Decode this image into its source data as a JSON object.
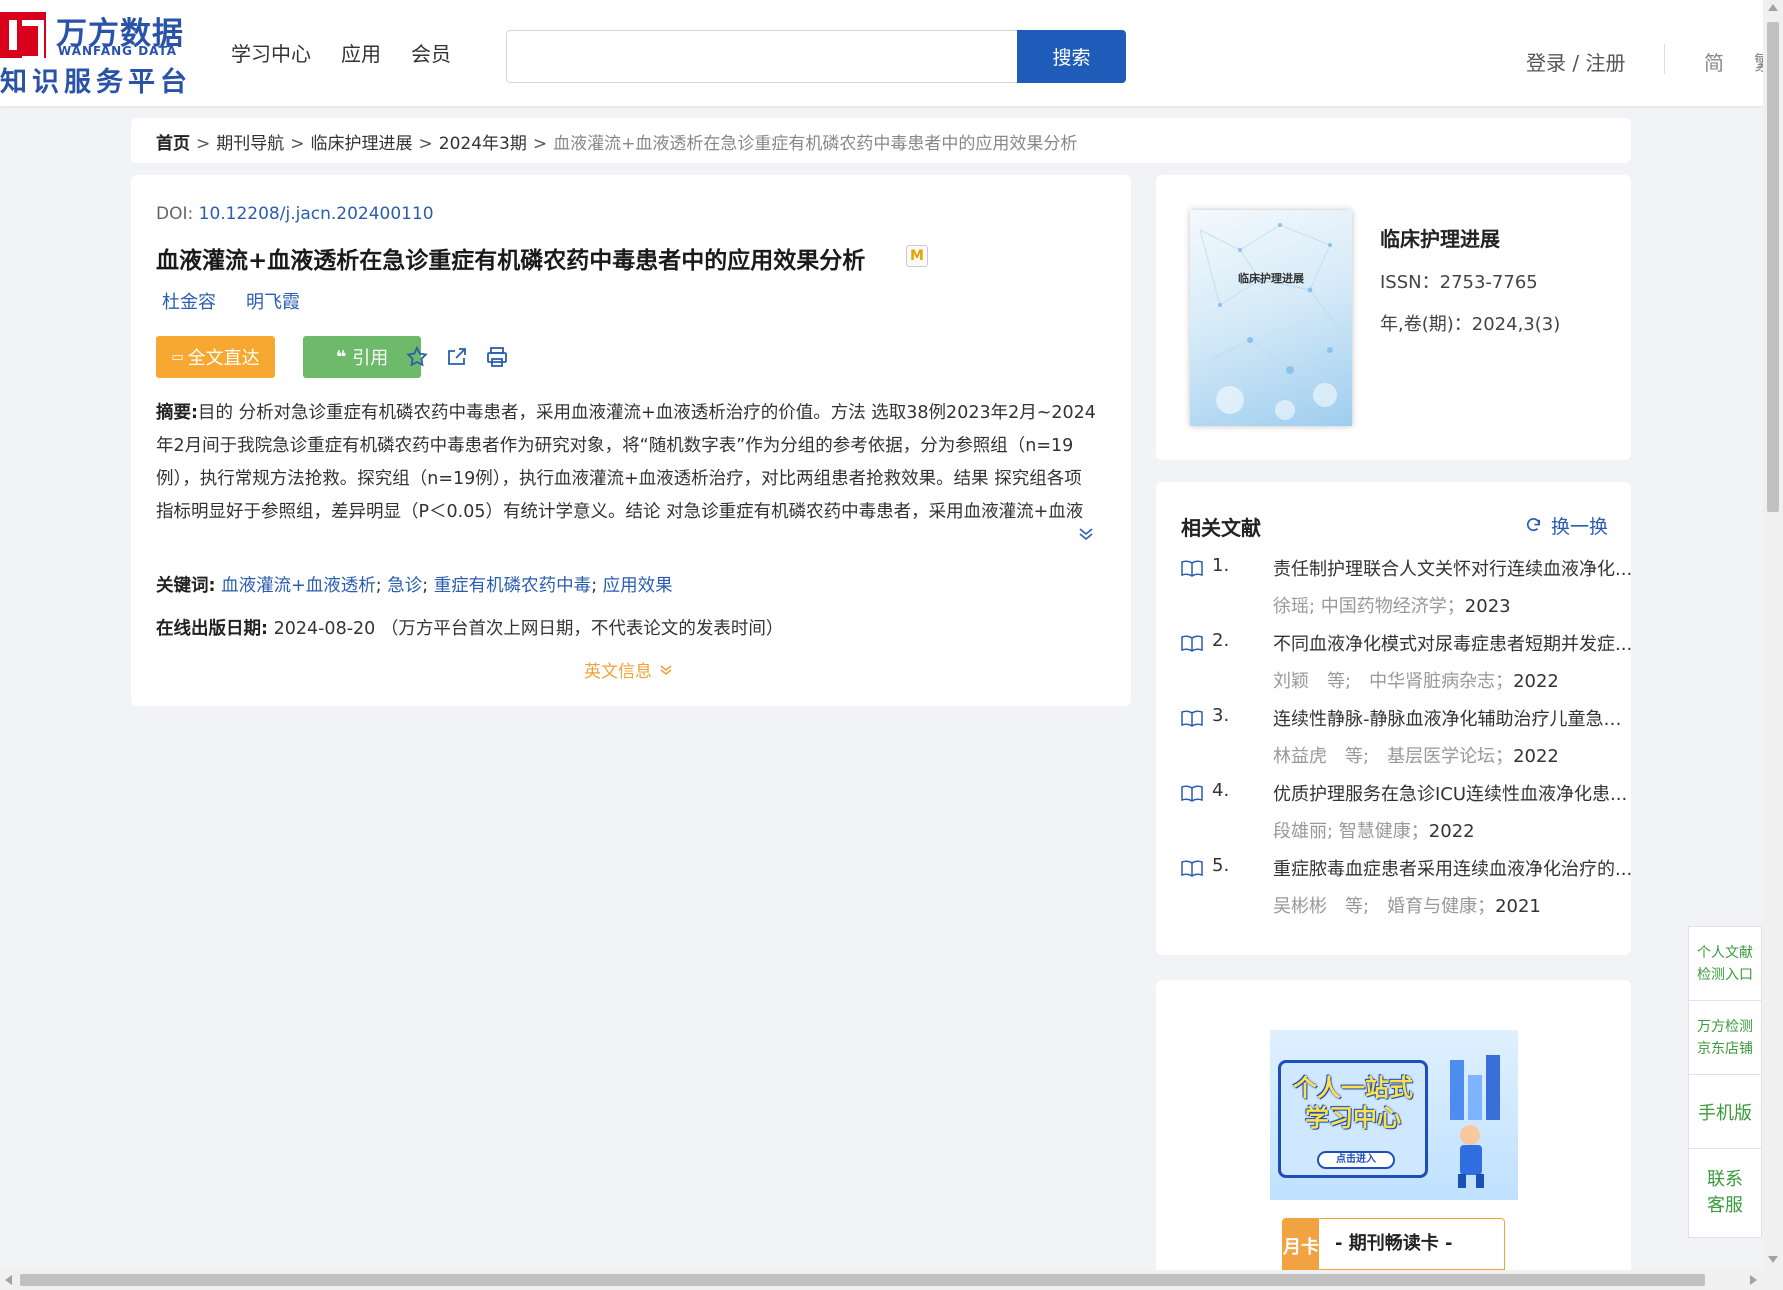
{
  "header": {
    "logo_cn": "万方数据",
    "logo_en": "WANFANG DATA",
    "logo_sub": "知识服务平台",
    "nav": [
      "学习中心",
      "应用",
      "会员"
    ],
    "search_placeholder": "",
    "search_button": "搜索",
    "login": "登录 / 注册",
    "lang_simplified": "简",
    "lang_traditional": "繁"
  },
  "breadcrumb": {
    "home": "首页",
    "items": [
      "期刊导航",
      "临床护理进展",
      "2024年3期"
    ],
    "current": "血液灌流+血液透析在急诊重症有机磷农药中毒患者中的应用效果分析",
    "separator": ">"
  },
  "article": {
    "doi_label": "DOI:",
    "doi": "10.12208/j.jacn.202400110",
    "title": "血液灌流+血液透析在急诊重症有机磷农药中毒患者中的应用效果分析",
    "badge": "M",
    "authors": [
      "杜金容",
      "明飞霞"
    ],
    "btn_full_text": "全文直达",
    "btn_cite": "引用",
    "abstract_label": "摘要:",
    "abstract": "目的 分析对急诊重症有机磷农药中毒患者，采用血液灌流+血液透析治疗的价值。方法 选取38例2023年2月~2024年2月间于我院急诊重症有机磷农药中毒患者作为研究对象，将“随机数字表”作为分组的参考依据，分为参照组（n=19例），执行常规方法抢救。探究组（n=19例），执行血液灌流+血液透析治疗，对比两组患者抢救效果。结果 探究组各项指标明显好于参照组，差异明显（P＜0.05）有统计学意义。结论 对急诊重症有机磷农药中毒患者，采用血液灌流+血液透析治疗，有助于提高患者治疗有效率，降低患者并发症，对改善患者苏醒时间，住院时间，胆碱酯酶恢复正常时间，阿...",
    "keywords_label": "关键词:",
    "keywords": [
      "血液灌流+血液透析",
      "急诊",
      "重症有机磷农药中毒",
      "应用效果"
    ],
    "pubdate_label": "在线出版日期:",
    "pubdate": "2024-08-20",
    "pubdate_note": "（万方平台首次上网日期，不代表论文的发表时间）",
    "english_info": "英文信息"
  },
  "journal": {
    "name": "临床护理进展",
    "cover_title": "临床护理进展",
    "issn": "ISSN：2753-7765",
    "volume": "年,卷(期)：2024,3(3)"
  },
  "related": {
    "heading": "相关文献",
    "refresh": "换一换",
    "items": [
      {
        "num": "1.",
        "title": "责任制护理联合人文关怀对行连续血液净化...",
        "meta": "徐瑶; 中国药物经济学；",
        "year": "2023"
      },
      {
        "num": "2.",
        "title": "不同血液净化模式对尿毒症患者短期并发症...",
        "meta": "刘颖　等;　中华肾脏病杂志；",
        "year": "2022"
      },
      {
        "num": "3.",
        "title": "连续性静脉-静脉血液净化辅助治疗儿童急性...",
        "meta": "林益虎　等;　基层医学论坛；",
        "year": "2022"
      },
      {
        "num": "4.",
        "title": "优质护理服务在急诊ICU连续性血液净化患...",
        "meta": "段雄丽; 智慧健康；",
        "year": "2022"
      },
      {
        "num": "5.",
        "title": "重症脓毒血症患者采用连续血液净化治疗的...",
        "meta": "吴彬彬　等;　婚育与健康；",
        "year": "2021"
      }
    ]
  },
  "promo": {
    "banner_line1": "个人一站式",
    "banner_line2": "学习中心",
    "banner_button": "点击进入",
    "card_tag": "月卡",
    "card_label": "- 期刊畅读卡 -"
  },
  "sidebar": {
    "item1": [
      "个人文献",
      "检测入口"
    ],
    "item2": [
      "万方检测",
      "京东店铺"
    ],
    "item3": "手机版",
    "item4": [
      "联系",
      "客服"
    ]
  }
}
